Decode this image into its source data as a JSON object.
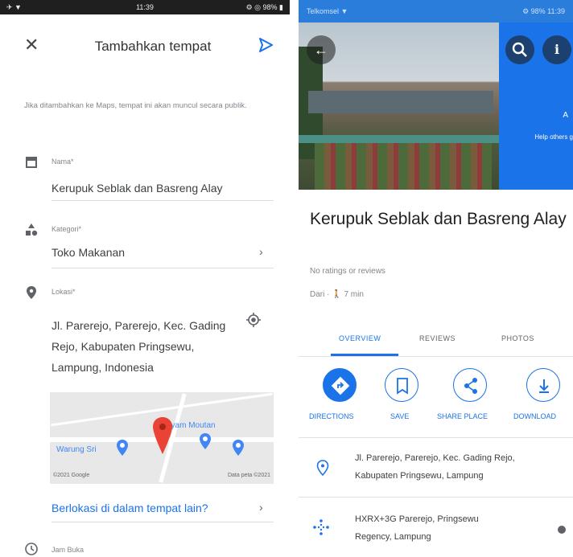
{
  "left": {
    "status": {
      "left": "✈ ▼",
      "time": "11:39",
      "right": "⚙ ◎ 98% ▮"
    },
    "title": "Tambahkan tempat",
    "notice": "Jika ditambahkan ke Maps, tempat ini akan muncul secara publik.",
    "name_label": "Nama*",
    "name_value": "Kerupuk Seblak dan Basreng Alay",
    "category_label": "Kategori*",
    "category_value": "Toko Makanan",
    "location_label": "Lokasi*",
    "address_value": "Jl. Parerejo, Parerejo, Kec. Gading Rejo, Kabupaten Pringsewu, Lampung, Indonesia",
    "map": {
      "label_warung": "Warung Sri",
      "label_mantan": "ayam Moutan",
      "credit_left": "©2021 Google",
      "credit_right": "Data peta ©2021"
    },
    "link": "Berlokasi di dalam tempat lain?",
    "hours_label": "Jam Buka",
    "colors": {
      "accent": "#1a73e8",
      "pin": "#ea4335"
    }
  },
  "right": {
    "status": {
      "left": "Telkomsel ▼",
      "right": "⚙ 98% 11:39"
    },
    "panel_title": "A",
    "panel_sub": "Help others g",
    "place_name": "Kerupuk Seblak dan Basreng Alay",
    "rating": "No ratings or reviews",
    "drive": "Dari · 🚶 7 min",
    "tabs": [
      "OVERVIEW",
      "REVIEWS",
      "PHOTOS"
    ],
    "actions": [
      "DIRECTIONS",
      "SAVE",
      "SHARE PLACE",
      "DOWNLOAD"
    ],
    "address_line1": "Jl. Parerejo, Parerejo, Kec. Gading Rejo,",
    "address_line2": "Kabupaten Pringsewu, Lampung",
    "pluscode_line1": "HXRX+3G Parerejo, Pringsewu",
    "pluscode_line2": "Regency, Lampung"
  }
}
